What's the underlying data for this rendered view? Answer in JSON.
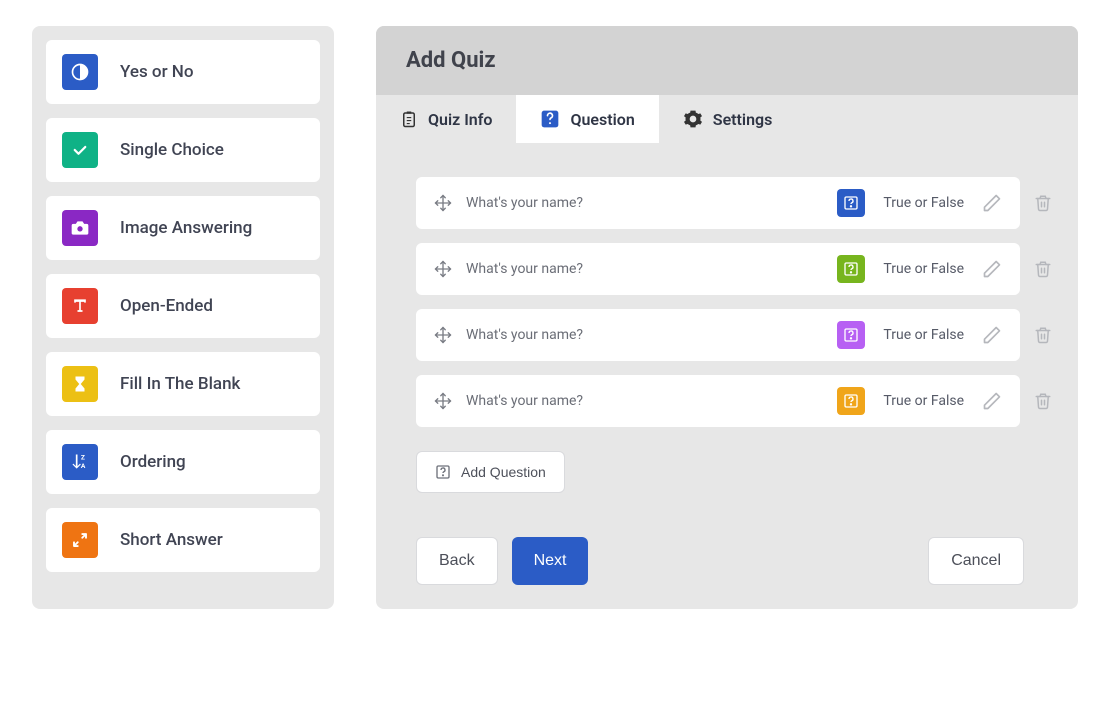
{
  "types": [
    {
      "label": "Yes or No",
      "color": "blue1",
      "icon": "contrast"
    },
    {
      "label": "Single Choice",
      "color": "green1",
      "icon": "check"
    },
    {
      "label": "Image Answering",
      "color": "purple",
      "icon": "camera"
    },
    {
      "label": "Open-Ended",
      "color": "red",
      "icon": "text"
    },
    {
      "label": "Fill In The Blank",
      "color": "yellow",
      "icon": "hourglass"
    },
    {
      "label": "Ordering",
      "color": "blue2",
      "icon": "sortza"
    },
    {
      "label": "Short Answer",
      "color": "orange",
      "icon": "expand"
    }
  ],
  "header": {
    "title": "Add Quiz"
  },
  "tabs": [
    {
      "label": "Quiz Info",
      "icon": "clipboard"
    },
    {
      "label": "Question",
      "icon": "question"
    },
    {
      "label": "Settings",
      "icon": "gear"
    }
  ],
  "active_tab": 1,
  "questions": [
    {
      "text": "What's your name?",
      "type_label": "True or False",
      "badge": "b-blue"
    },
    {
      "text": "What's your name?",
      "type_label": "True or False",
      "badge": "b-green"
    },
    {
      "text": "What's your name?",
      "type_label": "True or False",
      "badge": "b-purple"
    },
    {
      "text": "What's your name?",
      "type_label": "True or False",
      "badge": "b-amber"
    }
  ],
  "add_question": "Add Question",
  "back": "Back",
  "next": "Next",
  "cancel": "Cancel"
}
